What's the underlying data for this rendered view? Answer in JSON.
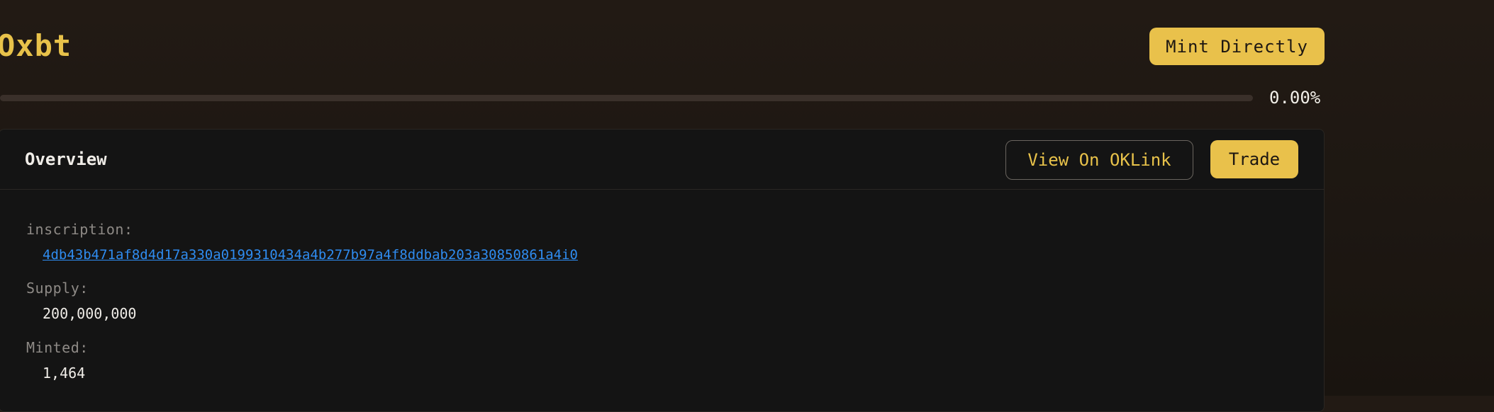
{
  "token": {
    "name": "Oxbt"
  },
  "actions": {
    "mint_label": "Mint Directly"
  },
  "progress": {
    "percent_text": "0.00%",
    "value": 0
  },
  "overview": {
    "title": "Overview",
    "view_on_oklink_label": "View On OKLink",
    "trade_label": "Trade",
    "fields": {
      "inscription_label": "inscription:",
      "inscription_value": "4db43b471af8d4d17a330a0199310434a4b277b97a4f8ddbab203a30850861a4i0",
      "supply_label": "Supply:",
      "supply_value": "200,000,000",
      "minted_label": "Minted:",
      "minted_value": "1,464"
    }
  },
  "colors": {
    "accent": "#e9c14b",
    "link": "#2f8cf0",
    "panel_bg": "#141414",
    "page_bg": "#221a14"
  }
}
